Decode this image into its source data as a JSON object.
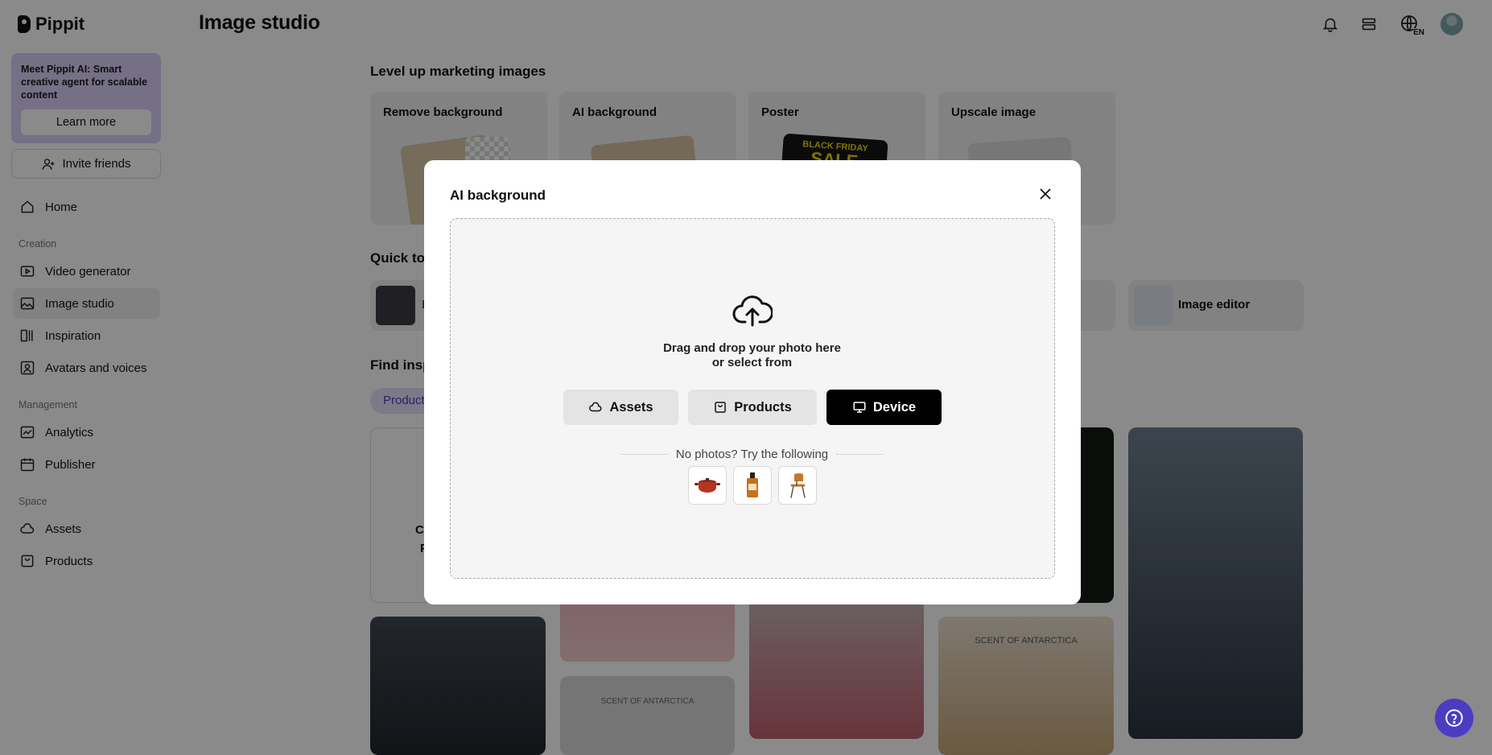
{
  "app": {
    "name": "Pippit"
  },
  "sidebar": {
    "promo": {
      "text": "Meet Pippit AI: Smart creative agent for scalable content",
      "button": "Learn more"
    },
    "invite": "Invite friends",
    "home": "Home",
    "sections": {
      "creation": "Creation",
      "management": "Management",
      "space": "Space"
    },
    "items": {
      "video_generator": "Video generator",
      "image_studio": "Image studio",
      "inspiration": "Inspiration",
      "avatars": "Avatars and voices",
      "analytics": "Analytics",
      "publisher": "Publisher",
      "assets": "Assets",
      "products": "Products"
    },
    "active": "Image studio"
  },
  "header": {
    "title": "Image studio",
    "language": "EN"
  },
  "main": {
    "marketing_title": "Level up marketing images",
    "cards": [
      "Remove background",
      "AI background",
      "Poster",
      "Upscale image"
    ],
    "poster_thumb_text": [
      "BLACK FRIDAY",
      "SALE"
    ],
    "quick_tools_title": "Quick to",
    "quick_tools_partial": "I",
    "image_editor": "Image editor",
    "find_title": "Find insp",
    "chip": "Product",
    "create_card_partial": [
      "C",
      "P"
    ],
    "scent_label": "SCENT OF ANTARCTICA"
  },
  "modal": {
    "title": "AI background",
    "drop_line1": "Drag and drop your photo here",
    "drop_line2": "or select from",
    "buttons": {
      "assets": "Assets",
      "products": "Products",
      "device": "Device"
    },
    "try_text": "No photos? Try the following",
    "samples": [
      "pot-icon",
      "bottle-icon",
      "chair-icon"
    ]
  },
  "colors": {
    "accent": "#4b3cc2",
    "promo_bg": "#d8cff7",
    "dark_button": "#000000"
  }
}
